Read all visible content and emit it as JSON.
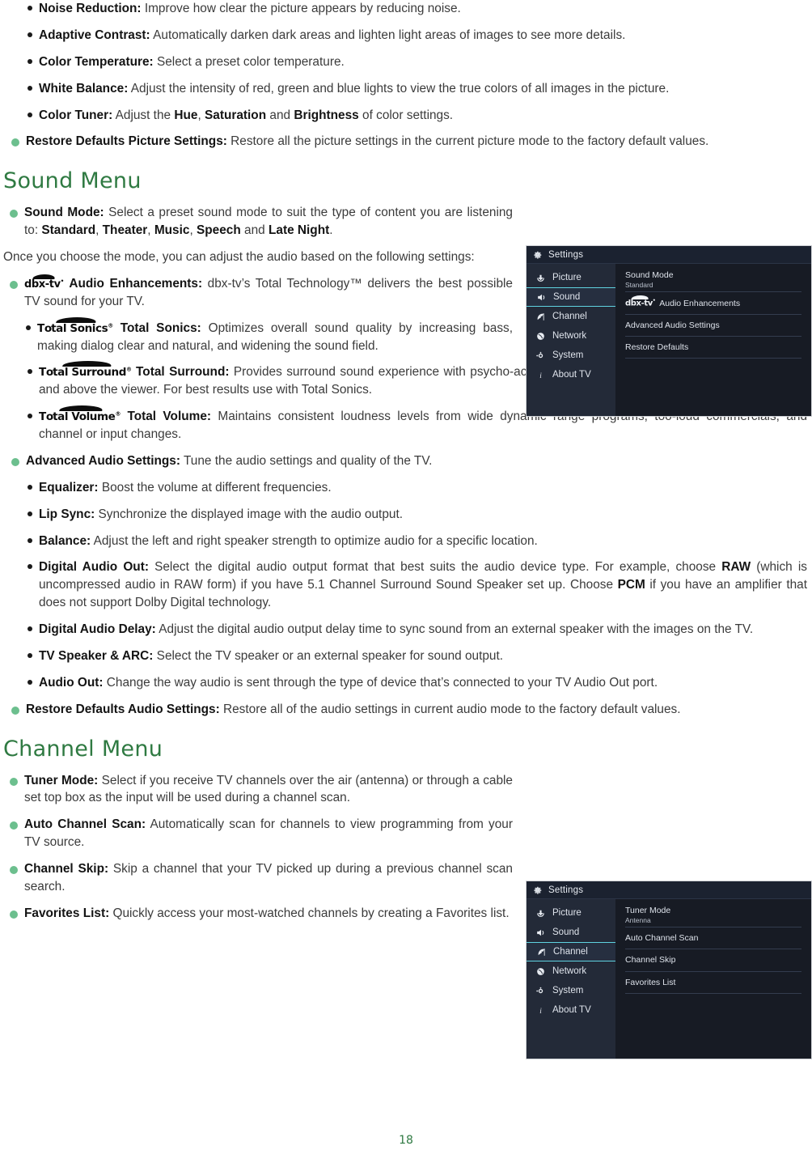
{
  "page_number": "18",
  "colors": {
    "heading_green": "#2f7a42",
    "bullet_green": "#6cbf8e",
    "panel_bg": "#171b24",
    "panel_sidebar": "#232a38",
    "panel_header": "#1b2230",
    "panel_highlight": "#5fd3e0"
  },
  "picture_menu_tail": {
    "bullets": [
      {
        "level": 2,
        "term": "Noise Reduction:",
        "text": " Improve how clear the picture appears by reducing noise."
      },
      {
        "level": 2,
        "term": "Adaptive Contrast:",
        "text": " Automatically darken dark areas and lighten light areas of images to see more details."
      },
      {
        "level": 2,
        "term": "Color Temperature:",
        "text": " Select a preset color temperature."
      },
      {
        "level": 2,
        "term": "White Balance:",
        "text": " Adjust the intensity of red, green and blue lights to view the true colors of all images in the picture."
      },
      {
        "level": 2,
        "term": "Color Tuner:",
        "text": " Adjust the Hue, Saturation and Brightness of color settings."
      },
      {
        "level": 1,
        "term": "Restore Defaults Picture Settings:",
        "text": " Restore all the picture settings in the current picture mode to the factory default values."
      }
    ]
  },
  "sound_menu": {
    "heading": "Sound Menu",
    "sound_mode": {
      "term": "Sound Mode:",
      "text": " Select a preset sound mode to suit the type of content you are listening to: Standard, Theater, Music, Speech and Late Night."
    },
    "intro_paragraph": "Once you choose the mode, you can adjust the audio based on the following settings:",
    "audio_enhancements": {
      "logo": "dbx-tv",
      "term": "Audio Enhancements:",
      "text": " dbx-tv’s Total Technology™ delivers the best possible TV sound for your TV."
    },
    "enhancement_items": [
      {
        "logo": "Total Sonics",
        "term": "Total Sonics:",
        "text": " Optimizes overall sound quality by increasing bass, making dialog clear and natural, and widening the sound field."
      },
      {
        "logo": "Total Surround",
        "term": "Total Surround:",
        "text": " Provides surround sound experience with psycho-acoustic processing to place sounds beside, behind, and above the viewer. For best results use with Total Sonics."
      },
      {
        "logo": "Total Volume",
        "term": "Total Volume:",
        "text": " Maintains consistent loudness levels from wide dynamic range programs, too-loud commercials, and channel or input changes."
      }
    ],
    "advanced_audio": {
      "term": "Advanced Audio Settings:",
      "text": " Tune the audio settings and quality of the TV."
    },
    "advanced_items": [
      {
        "term": "Equalizer:",
        "text": " Boost the volume at different frequencies."
      },
      {
        "term": "Lip Sync:",
        "text": " Synchronize the displayed image with the audio output."
      },
      {
        "term": "Balance:",
        "text": " Adjust the left and right speaker strength to optimize audio for a specific location."
      },
      {
        "term": "Digital Audio Out:",
        "text": " Select the digital audio output format that best suits the audio device type. For example, choose RAW (which is uncompressed audio in RAW form) if you have 5.1 Channel Surround Sound Speaker set up. Choose PCM if you have an amplifier that does not support Dolby Digital technology."
      },
      {
        "term": "Digital Audio Delay:",
        "text": " Adjust the digital audio output delay time to sync sound from an external speaker with the images on the TV."
      },
      {
        "term": "TV Speaker & ARC:",
        "text": " Select the TV speaker or an external speaker for sound output."
      },
      {
        "term": "Audio Out:",
        "text": " Change the way audio is sent through the type of device that’s connected to your TV Audio Out port."
      }
    ],
    "restore_defaults": {
      "term": "Restore Defaults Audio Settings:",
      "text": " Restore all of the audio settings in current audio mode to the factory default values."
    }
  },
  "channel_menu": {
    "heading": "Channel Menu",
    "bullets": [
      {
        "term": "Tuner Mode:",
        "text": " Select if you receive TV channels over the air (antenna) or through a cable set top box as the input will be used during a channel scan."
      },
      {
        "term": "Auto Channel Scan:",
        "text": " Automatically scan for channels to view programming from your TV source."
      },
      {
        "term": "Channel Skip:",
        "text": " Skip a channel that your TV picked up during a previous channel scan search."
      },
      {
        "term": "Favorites List:",
        "text": " Quickly access your most-watched channels by creating a Favorites list."
      }
    ]
  },
  "tv_panel_sound": {
    "header_title": "Settings",
    "sidebar": [
      {
        "label": "Picture",
        "icon": "picture-icon",
        "selected": false
      },
      {
        "label": "Sound",
        "icon": "sound-icon",
        "selected": true
      },
      {
        "label": "Channel",
        "icon": "channel-icon",
        "selected": false
      },
      {
        "label": "Network",
        "icon": "network-icon",
        "selected": false
      },
      {
        "label": "System",
        "icon": "system-icon",
        "selected": false
      },
      {
        "label": "About TV",
        "icon": "about-icon",
        "selected": false
      }
    ],
    "rows": [
      {
        "label": "Sound Mode",
        "value": "Standard",
        "logo": ""
      },
      {
        "label": "Audio Enhancements",
        "value": "",
        "logo": "dbx-tv"
      },
      {
        "label": "Advanced Audio Settings",
        "value": "",
        "logo": ""
      },
      {
        "label": "Restore Defaults",
        "value": "",
        "logo": ""
      }
    ]
  },
  "tv_panel_channel": {
    "header_title": "Settings",
    "sidebar": [
      {
        "label": "Picture",
        "icon": "picture-icon",
        "selected": false
      },
      {
        "label": "Sound",
        "icon": "sound-icon",
        "selected": false
      },
      {
        "label": "Channel",
        "icon": "channel-icon",
        "selected": true
      },
      {
        "label": "Network",
        "icon": "network-icon",
        "selected": false
      },
      {
        "label": "System",
        "icon": "system-icon",
        "selected": false
      },
      {
        "label": "About TV",
        "icon": "about-icon",
        "selected": false
      }
    ],
    "rows": [
      {
        "label": "Tuner Mode",
        "value": "Antenna",
        "logo": ""
      },
      {
        "label": "Auto Channel Scan",
        "value": "",
        "logo": ""
      },
      {
        "label": "Channel Skip",
        "value": "",
        "logo": ""
      },
      {
        "label": "Favorites List",
        "value": "",
        "logo": ""
      }
    ]
  }
}
